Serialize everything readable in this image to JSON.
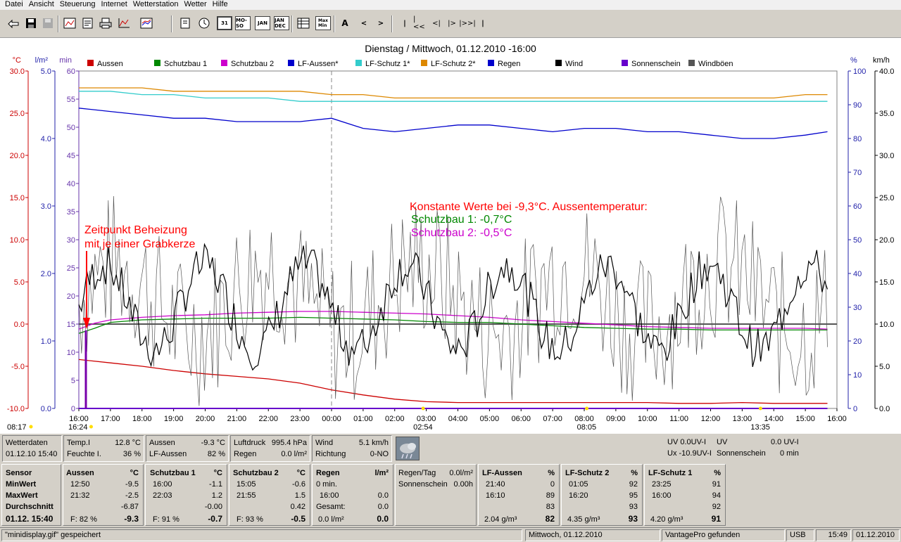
{
  "menu": [
    "Datei",
    "Ansicht",
    "Steuerung",
    "Internet",
    "Wetterstation",
    "Wetter",
    "Hilfe"
  ],
  "toolbar": {
    "period_day": "31",
    "period_week": "MO-SO",
    "period_month": "JAN",
    "period_year": "JAN DEC",
    "btn_a": "A",
    "nav_prev": "<",
    "nav_next": ">",
    "nav_first": "|",
    "nav_b1": "|<<",
    "nav_b2": "<|",
    "nav_f1": "|>",
    "nav_f2": "|>>|",
    "nav_last": "|"
  },
  "chart_data": {
    "type": "line",
    "title": "Dienstag / Mittwoch, 01.12.2010  -16:00",
    "axis_unit_temp": "°C",
    "axis_unit_rain": "l/m²",
    "axis_unit_min": "min",
    "axis_unit_pct": "%",
    "axis_unit_kmh": "km/h",
    "temp_ticks": [
      "30.0",
      "25.0",
      "20.0",
      "15.0",
      "10.0",
      "5.0",
      "0.0",
      "-5.0",
      "-10.0"
    ],
    "rain_ticks": [
      "5.0",
      "4.0",
      "3.0",
      "2.0",
      "1.0",
      "0.0"
    ],
    "min_ticks": [
      "60",
      "55",
      "50",
      "45",
      "40",
      "35",
      "30",
      "25",
      "20",
      "15",
      "10",
      "5",
      "0"
    ],
    "pct_ticks": [
      "100",
      "90",
      "80",
      "70",
      "60",
      "50",
      "40",
      "30",
      "20",
      "10",
      "0"
    ],
    "kmh_ticks": [
      "40.0",
      "35.0",
      "30.0",
      "25.0",
      "20.0",
      "15.0",
      "10.0",
      "5.0",
      "0.0"
    ],
    "x_ticks": [
      "16:00",
      "17:00",
      "18:00",
      "19:00",
      "20:00",
      "21:00",
      "22:00",
      "23:00",
      "00:00",
      "01:00",
      "02:00",
      "03:00",
      "04:00",
      "05:00",
      "06:00",
      "07:00",
      "08:00",
      "09:00",
      "10:00",
      "11:00",
      "12:00",
      "13:00",
      "14:00",
      "15:00",
      "16:00"
    ],
    "legend": [
      {
        "name": "Aussen",
        "color": "#cc0000"
      },
      {
        "name": "Schutzbau 1",
        "color": "#008800"
      },
      {
        "name": "Schutzbau 2",
        "color": "#cc00cc"
      },
      {
        "name": "LF-Aussen*",
        "color": "#0000cc"
      },
      {
        "name": "LF-Schutz 1*",
        "color": "#33cccc"
      },
      {
        "name": "LF-Schutz 2*",
        "color": "#dd8800"
      },
      {
        "name": "Regen",
        "color": "#0000cc"
      },
      {
        "name": "Wind",
        "color": "#000000"
      },
      {
        "name": "Sonnenschein",
        "color": "#6600cc"
      },
      {
        "name": "Windböen",
        "color": "#555555"
      }
    ],
    "sun_markers": [
      {
        "label": "08:17",
        "x_hour": -7.72
      },
      {
        "label": "16:24",
        "x_hour": 0.4
      },
      {
        "label": "02:54",
        "x_hour": 10.9
      },
      {
        "label": "08:05",
        "x_hour": 16.08
      },
      {
        "label": "13:35",
        "x_hour": 21.58
      }
    ],
    "series": [
      {
        "name": "Aussen",
        "unit": "°C",
        "x": [
          0,
          1,
          2,
          3,
          4,
          5,
          6,
          7,
          8,
          9,
          10,
          11,
          12,
          13,
          14,
          15,
          16,
          17,
          18,
          19,
          20,
          21,
          22,
          23,
          23.7
        ],
        "values": [
          -4.2,
          -4.6,
          -5.0,
          -5.5,
          -5.9,
          -6.2,
          -6.5,
          -7.0,
          -7.8,
          -8.4,
          -8.9,
          -9.2,
          -9.3,
          -9.3,
          -9.3,
          -9.3,
          -9.3,
          -9.3,
          -9.3,
          -9.4,
          -9.4,
          -9.3,
          -9.4,
          -9.4,
          -9.4
        ]
      },
      {
        "name": "Schutzbau 1",
        "unit": "°C",
        "x": [
          0,
          0.5,
          1,
          2,
          3,
          4,
          5,
          6,
          7,
          8,
          9,
          10,
          11,
          12,
          13,
          14,
          15,
          16,
          17,
          18,
          19,
          20,
          21,
          22,
          23,
          23.7
        ],
        "values": [
          -1.1,
          -0.5,
          0.2,
          0.5,
          0.6,
          0.7,
          0.7,
          0.7,
          0.8,
          0.7,
          0.6,
          0.5,
          0.3,
          0.2,
          0.2,
          0.0,
          -0.2,
          -0.4,
          -0.5,
          -0.6,
          -0.6,
          -0.7,
          -0.7,
          -0.7,
          -0.7,
          -0.7
        ]
      },
      {
        "name": "Schutzbau 2",
        "unit": "°C",
        "x": [
          0,
          0.5,
          1,
          2,
          3,
          4,
          5,
          6,
          7,
          8,
          9,
          10,
          11,
          12,
          13,
          14,
          15,
          16,
          17,
          18,
          19,
          20,
          21,
          22,
          23,
          23.7
        ],
        "values": [
          -0.6,
          0.1,
          0.5,
          0.8,
          1.0,
          1.1,
          1.3,
          1.4,
          1.5,
          1.5,
          1.4,
          1.3,
          1.2,
          1.0,
          0.8,
          0.5,
          0.3,
          0.1,
          -0.1,
          -0.3,
          -0.4,
          -0.5,
          -0.5,
          -0.5,
          -0.5,
          -0.6
        ]
      },
      {
        "name": "LF-Aussen*",
        "unit": "%",
        "x": [
          0,
          1,
          2,
          3,
          4,
          5,
          6,
          7,
          8,
          9,
          10,
          11,
          12,
          13,
          14,
          15,
          16,
          17,
          18,
          19,
          20,
          21,
          22,
          23,
          23.7
        ],
        "values": [
          89,
          88,
          87,
          86,
          86,
          85,
          85,
          85,
          86,
          83,
          82,
          83,
          84,
          84,
          83,
          82,
          83,
          83,
          82,
          82,
          81,
          80,
          80,
          81,
          82
        ]
      },
      {
        "name": "LF-Schutz 1*",
        "unit": "%",
        "x": [
          0,
          1,
          2,
          3,
          4,
          5,
          6,
          7,
          8,
          9,
          10,
          11,
          12,
          13,
          14,
          15,
          16,
          17,
          18,
          19,
          20,
          21,
          22,
          23,
          23.7
        ],
        "values": [
          94,
          94,
          93,
          93,
          92,
          92,
          92,
          91,
          91,
          91,
          91,
          91,
          91,
          91,
          91,
          91,
          91,
          91,
          91,
          91,
          91,
          91,
          91,
          91,
          91
        ]
      },
      {
        "name": "LF-Schutz 2*",
        "unit": "%",
        "x": [
          0,
          1,
          2,
          3,
          4,
          5,
          6,
          7,
          8,
          9,
          10,
          11,
          12,
          13,
          14,
          15,
          16,
          17,
          18,
          19,
          20,
          21,
          22,
          23,
          23.7
        ],
        "values": [
          95,
          95,
          95,
          94,
          94,
          94,
          94,
          94,
          93,
          93,
          92,
          92,
          92,
          92,
          92,
          92,
          92,
          92,
          92,
          92,
          92,
          92,
          92,
          93,
          93
        ]
      },
      {
        "name": "Regen",
        "unit": "l/m²",
        "x": [
          0,
          23.7
        ],
        "values": [
          0,
          0
        ]
      },
      {
        "name": "Sonnenschein",
        "unit": "min",
        "x": [
          0,
          23.7
        ],
        "values": [
          0,
          0
        ]
      }
    ],
    "annotations": {
      "left_line1": "Zeitpunkt Beheizung",
      "left_line2": "mit je einer Grabkerze",
      "const_line1": "Konstante Werte bei -9,3°C. Aussentemperatur:",
      "const_line2": "Schutzbau 1: -0,7°C",
      "const_line3": "Schutzbau 2: -0,5°C"
    },
    "reference_line_temp": 0.0,
    "grid": false,
    "legend_position": "top"
  },
  "status1": {
    "wetterdaten": "Wetterdaten",
    "datetime": "01.12.10 15:40",
    "temp_i_label": "Temp.I",
    "temp_i_val": "12.8 °C",
    "feuchte_i_label": "Feuchte I.",
    "feuchte_i_val": "36 %",
    "aussen_label": "Aussen",
    "aussen_val": "-9.3 °C",
    "lf_aussen_label": "LF-Aussen",
    "lf_aussen_val": "82 %",
    "luftdruck_label": "Luftdruck",
    "luftdruck_val": "995.4 hPa",
    "regen_label": "Regen",
    "regen_val": "0.0 l/m²",
    "wind_label": "Wind",
    "wind_val": "5.1 km/h",
    "richtung_label": "Richtung",
    "richtung_val": "0-NO",
    "uv_line1": "UV  0.0UV-I",
    "ux_line": "Ux -10.9UV-I",
    "uv2_label": "UV",
    "uv2_val": "0.0 UV-I",
    "sonnenschein_label": "Sonnenschein",
    "sonnenschein_val": "0 min"
  },
  "sensor": {
    "col0": {
      "h": "Sensor",
      "r1": "MinWert",
      "r2": "MaxWert",
      "r3": "Durchschnitt",
      "r4": "01.12. 15:40"
    },
    "aussen": {
      "h": "Aussen",
      "unit": "°C",
      "min_t": "12:50",
      "min_v": "-9.5",
      "max_t": "21:32",
      "max_v": "-2.5",
      "avg": "-6.87",
      "f": "F: 82 %",
      "cur": "-9.3"
    },
    "sb1": {
      "h": "Schutzbau 1",
      "unit": "°C",
      "min_t": "16:00",
      "min_v": "-1.1",
      "max_t": "22:03",
      "max_v": "1.2",
      "avg": "-0.00",
      "f": "F: 91 %",
      "cur": "-0.7"
    },
    "sb2": {
      "h": "Schutzbau 2",
      "unit": "°C",
      "min_t": "15:05",
      "min_v": "-0.6",
      "max_t": "21:55",
      "max_v": "1.5",
      "avg": "0.42",
      "f": "F: 93 %",
      "cur": "-0.5"
    },
    "regen": {
      "h": "Regen",
      "unit": "l/m²",
      "r1": "0 min.",
      "r2_t": "16:00",
      "r2_v": "0.0",
      "r3": "Gesamt:",
      "r3_v": "0.0",
      "r4": "0.0 l/m²",
      "cur": "0.0"
    },
    "regentag": {
      "r1l": "Regen/Tag",
      "r1v": "0.0l/m²",
      "r2l": "Sonnenschein",
      "r2v": "0.00h"
    },
    "lfa": {
      "h": "LF-Aussen",
      "unit": "%",
      "min_t": "21:40",
      "min_v": "0",
      "max_t": "16:10",
      "max_v": "89",
      "avg": "83",
      "abs": "2.04 g/m³",
      "cur": "82"
    },
    "lfs2": {
      "h": "LF-Schutz 2",
      "unit": "%",
      "min_t": "01:05",
      "min_v": "92",
      "max_t": "16:20",
      "max_v": "95",
      "avg": "93",
      "abs": "4.35 g/m³",
      "cur": "93"
    },
    "lfs1": {
      "h": "LF-Schutz 1",
      "unit": "%",
      "min_t": "23:25",
      "min_v": "91",
      "max_t": "16:00",
      "max_v": "94",
      "avg": "92",
      "abs": "4.20 g/m³",
      "cur": "91"
    }
  },
  "bottom": {
    "msg": "\"minidisplay.gif\" gespeichert",
    "date": "Mittwoch, 01.12.2010",
    "conn": "VantagePro gefunden",
    "port": "USB",
    "time": "15:49",
    "date2": "01.12.2010"
  }
}
